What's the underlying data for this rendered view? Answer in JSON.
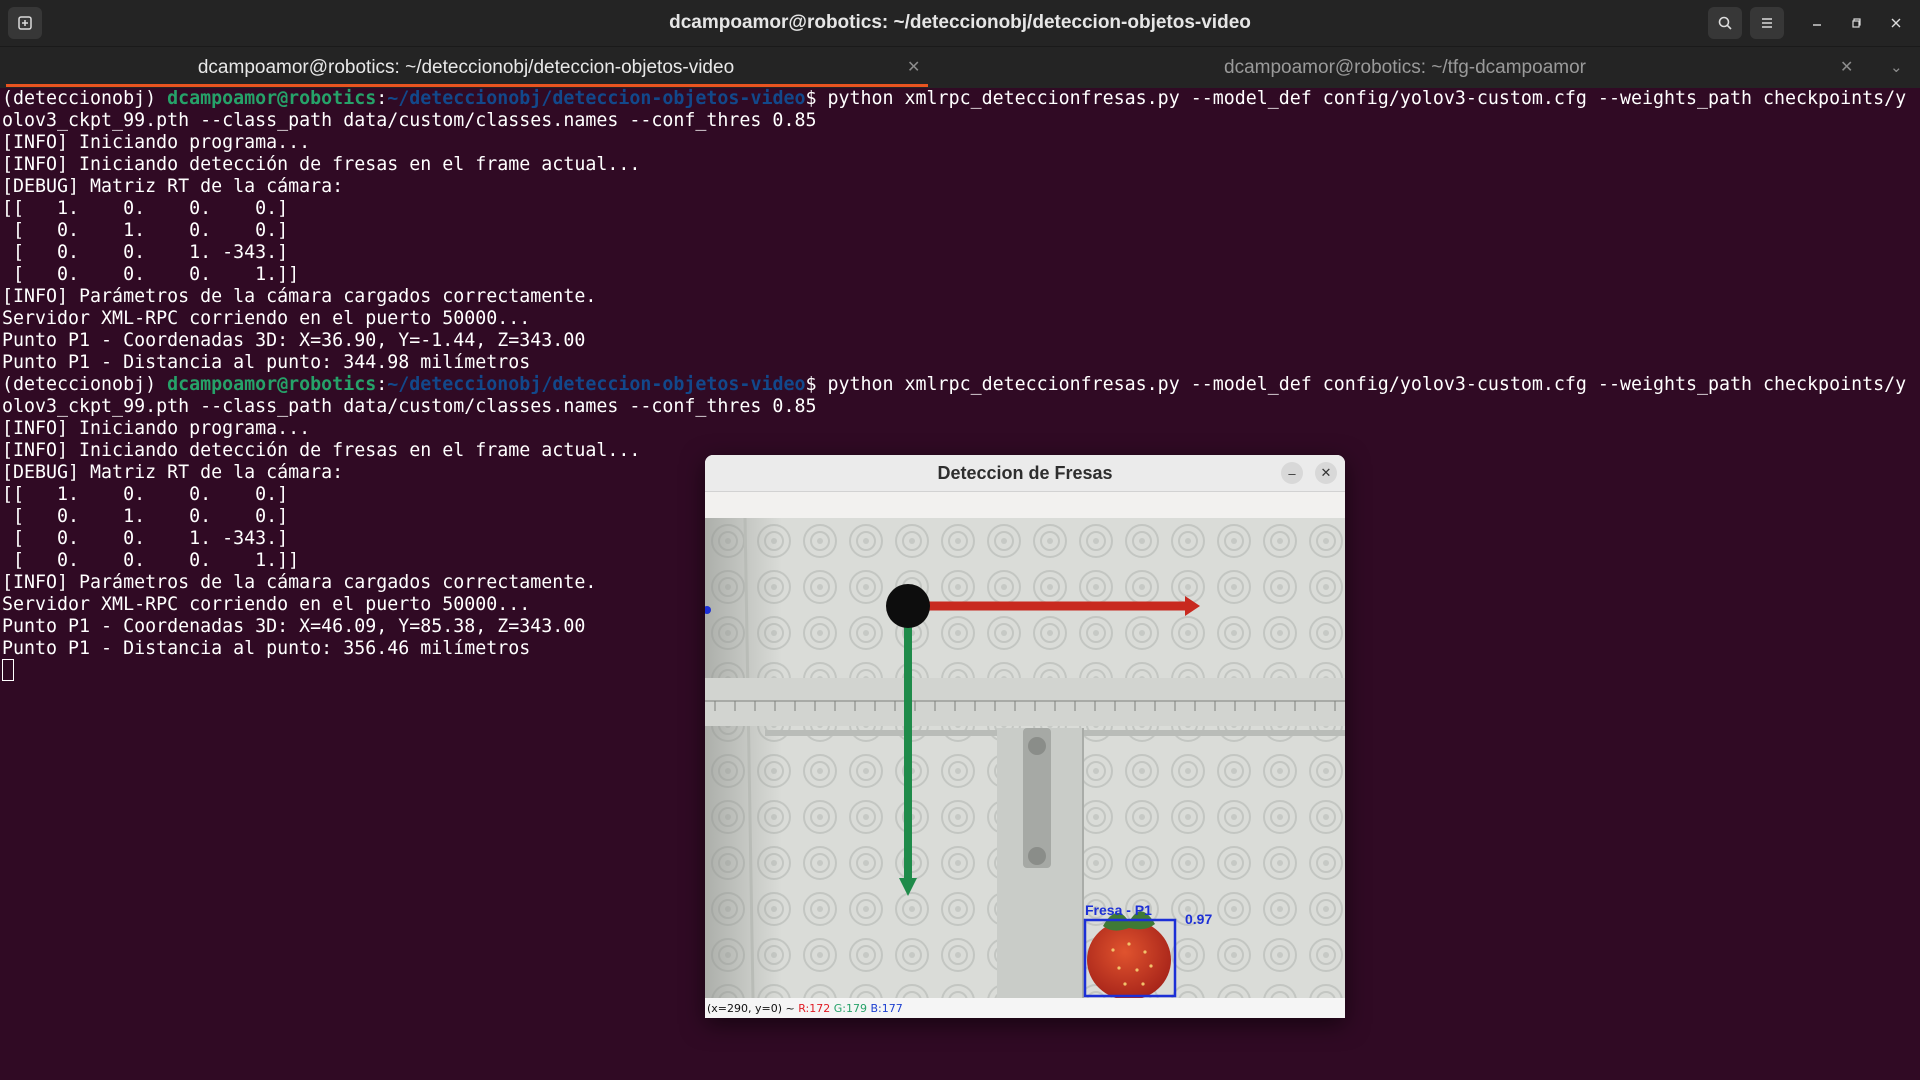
{
  "window": {
    "title": "dcampoamor@robotics: ~/deteccionobj/deteccion-objetos-video"
  },
  "tabs": [
    {
      "label": "dcampoamor@robotics: ~/deteccionobj/deteccion-objetos-video",
      "active": true
    },
    {
      "label": "dcampoamor@robotics: ~/tfg-dcampoamor",
      "active": false
    }
  ],
  "prompt": {
    "env": "(deteccionobj) ",
    "user": "dcampoamor@robotics",
    "sep": ":",
    "path": "~/deteccionobj/deteccion-objetos-video",
    "symbol": "$ ",
    "command_part1": "python xmlrpc_deteccionfresas.py --model_def config/yolov3-custom.cfg --weights_path checkpoints/y",
    "command_part2": "olov3_ckpt_99.pth --class_path data/custom/classes.names --conf_thres 0.85"
  },
  "run1": [
    "[INFO] Iniciando programa...",
    "[INFO] Iniciando detección de fresas en el frame actual...",
    "[DEBUG] Matriz RT de la cámara:",
    "[[   1.    0.    0.    0.]",
    " [   0.    1.    0.    0.]",
    " [   0.    0.    1. -343.]",
    " [   0.    0.    0.    1.]]",
    "[INFO] Parámetros de la cámara cargados correctamente.",
    "Servidor XML-RPC corriendo en el puerto 50000...",
    "Punto P1 - Coordenadas 3D: X=36.90, Y=-1.44, Z=343.00",
    "Punto P1 - Distancia al punto: 344.98 milímetros"
  ],
  "run2": [
    "[INFO] Iniciando programa...",
    "[INFO] Iniciando detección de fresas en el frame actual...",
    "[DEBUG] Matriz RT de la cámara:",
    "[[   1.    0.    0.    0.]",
    " [   0.    1.    0.    0.]",
    " [   0.    0.    1. -343.]",
    " [   0.    0.    0.    1.]]",
    "[INFO] Parámetros de la cámara cargados correctamente.",
    "Servidor XML-RPC corriendo en el puerto 50000...",
    "Punto P1 - Coordenadas 3D: X=46.09, Y=85.38, Z=343.00",
    "Punto P1 - Distancia al punto: 356.46 milímetros"
  ],
  "cv_window": {
    "title": "Deteccion de Fresas",
    "detection_label": "Fresa - P1",
    "confidence": "0.97",
    "status_prefix": "(x=290, y=0) ~ ",
    "status_r": "R:172",
    "status_g": "G:179",
    "status_b": "B:177"
  },
  "colors": {
    "terminal_bg": "#300a24",
    "prompt_user": "#26a269",
    "prompt_path": "#12488b",
    "tab_accent": "#e95420",
    "detection_box": "#1c2fd6"
  },
  "icons": {
    "new_tab": "new-tab-icon",
    "search": "search-icon",
    "menu": "hamburger-menu-icon",
    "minimize": "minimize-icon",
    "maximize": "maximize-icon",
    "close": "close-icon"
  }
}
